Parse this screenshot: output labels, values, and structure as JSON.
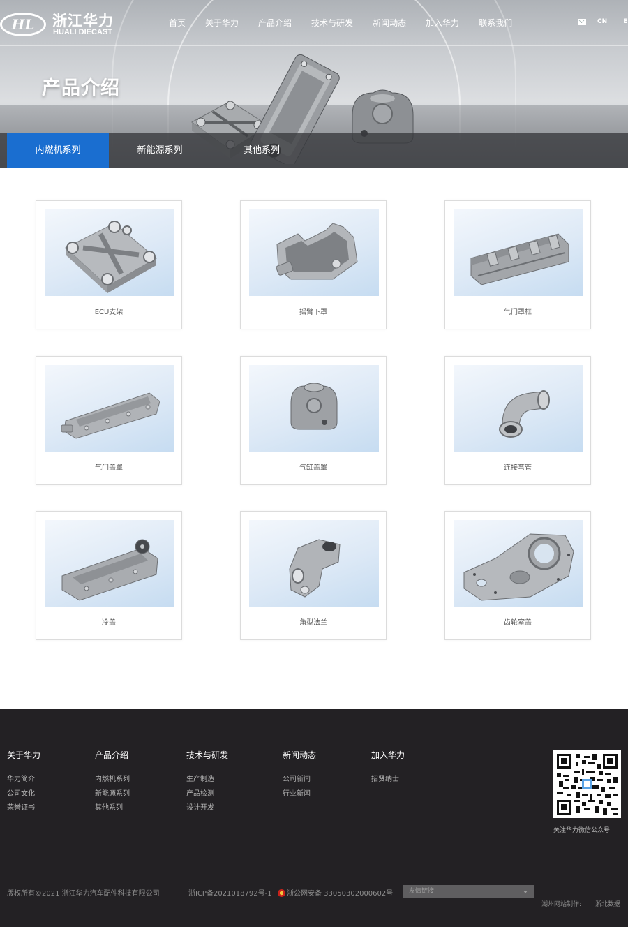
{
  "header": {
    "logo_mark": "HL",
    "logo_cn": "浙江华力",
    "logo_en": "HUALI DIECAST",
    "nav": [
      "首页",
      "关于华力",
      "产品介绍",
      "技术与研发",
      "新闻动态",
      "加入华力",
      "联系我们"
    ],
    "lang_cn": "CN",
    "lang_sep": "|",
    "lang_en": "EN"
  },
  "hero": {
    "title": "产品介绍",
    "tabs": [
      "内燃机系列",
      "新能源系列",
      "其他系列"
    ],
    "active_tab": 0,
    "active_color": "#1a6ed0"
  },
  "products": [
    {
      "name": "ECU支架",
      "icon": "ecu-bracket-icon"
    },
    {
      "name": "摇臂下罩",
      "icon": "rocker-lower-cover-icon"
    },
    {
      "name": "气门罩框",
      "icon": "valve-cover-frame-icon"
    },
    {
      "name": "气门盖罩",
      "icon": "valve-cover-icon"
    },
    {
      "name": "气缸盖罩",
      "icon": "cylinder-head-cover-icon"
    },
    {
      "name": "连接弯管",
      "icon": "elbow-pipe-icon"
    },
    {
      "name": "冷盖",
      "icon": "cooling-cover-icon"
    },
    {
      "name": "角型法兰",
      "icon": "angle-flange-icon"
    },
    {
      "name": "齿轮室盖",
      "icon": "gear-housing-cover-icon"
    }
  ],
  "footer": {
    "columns": [
      {
        "title": "关于华力",
        "links": [
          "华力简介",
          "公司文化",
          "荣誉证书"
        ]
      },
      {
        "title": "产品介绍",
        "links": [
          "内燃机系列",
          "新能源系列",
          "其他系列"
        ]
      },
      {
        "title": "技术与研发",
        "links": [
          "生产制造",
          "产品检测",
          "设计开发"
        ]
      },
      {
        "title": "新闻动态",
        "links": [
          "公司新闻",
          "行业新闻"
        ]
      },
      {
        "title": "加入华力",
        "links": [
          "招贤纳士"
        ]
      }
    ],
    "qr_label": "关注华力微信公众号",
    "copyright": "版权所有©2021 浙江华力汽车配件科技有限公司",
    "icp": "浙ICP备2021018792号-1",
    "police": "浙公网安备 33050302000602号",
    "friend_links_placeholder": "友情链接",
    "credit_site": "湖州网站制作:",
    "credit_company": "浙北数据"
  }
}
